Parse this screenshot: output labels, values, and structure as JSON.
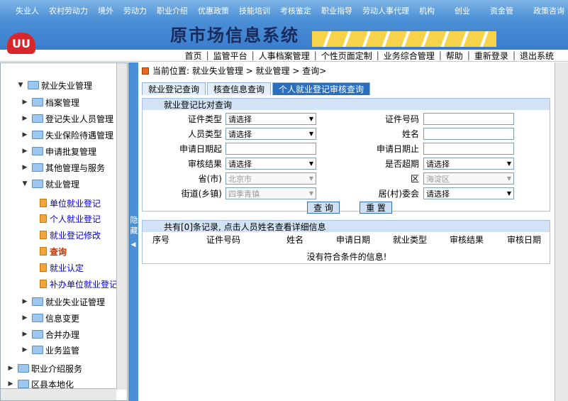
{
  "topnav": [
    "失业人",
    "农村劳动力",
    "境外",
    "劳动力",
    "职业介绍",
    "优惠政策",
    "技能培训",
    "考核鉴定",
    "职业指导",
    "劳动人事代理",
    "机构",
    "",
    "创业",
    "",
    "资金管",
    "",
    "政策咨询"
  ],
  "banner": {
    "logo": "UU",
    "title": "原市场信息系统"
  },
  "links": [
    "首页",
    "监管平台",
    "人事档案管理",
    "个性页面定制",
    "业务综合管理",
    "帮助",
    "重新登录",
    "退出系统"
  ],
  "tree": [
    {
      "label": "就业失业管理",
      "open": true,
      "kind": "folder"
    },
    {
      "label": "档案管理",
      "kind": "folder"
    },
    {
      "label": "登记失业人员管理",
      "kind": "folder"
    },
    {
      "label": "失业保险待遇管理",
      "kind": "folder"
    },
    {
      "label": "申请批复管理",
      "kind": "folder"
    },
    {
      "label": "其他管理与服务",
      "kind": "folder"
    },
    {
      "label": "就业管理",
      "open": true,
      "kind": "folder"
    },
    {
      "label": "单位就业登记",
      "kind": "doc"
    },
    {
      "label": "个人就业登记",
      "kind": "doc"
    },
    {
      "label": "就业登记修改",
      "kind": "doc"
    },
    {
      "label": "查询",
      "kind": "doc",
      "current": true
    },
    {
      "label": "就业认定",
      "kind": "doc"
    },
    {
      "label": "补办单位就业登记",
      "kind": "doc"
    },
    {
      "label": "就业失业证管理",
      "kind": "folder"
    },
    {
      "label": "信息变更",
      "kind": "folder"
    },
    {
      "label": "合并办理",
      "kind": "folder"
    },
    {
      "label": "业务监管",
      "kind": "folder"
    },
    {
      "label": "职业介绍服务",
      "kind": "folder"
    },
    {
      "label": "区县本地化",
      "kind": "folder"
    }
  ],
  "hidebar": "隐藏",
  "breadcrumb": "当前位置: 就业失业管理 > 就业管理 > 查询>",
  "tabs": [
    "就业登记查询",
    "核查信息查询",
    "个人就业登记审核查询"
  ],
  "form": {
    "header": "就业登记比对查询",
    "id_type_label": "证件类型",
    "id_type_value": "请选择",
    "id_no_label": "证件号码",
    "person_type_label": "人员类型",
    "person_type_value": "请选择",
    "name_label": "姓名",
    "start_label": "申请日期起",
    "end_label": "申请日期止",
    "audit_label": "审核结果",
    "audit_value": "请选择",
    "overdue_label": "是否超期",
    "overdue_value": "请选择",
    "province_label": "省(市)",
    "province_value": "北京市",
    "district_label": "区",
    "district_value": "海淀区",
    "street_label": "街道(乡镇)",
    "street_value": "四季青镇",
    "committee_label": "居(村)委会",
    "committee_value": "请选择",
    "query_button": "查 询",
    "reset_button": "重 置"
  },
  "results": {
    "header": "共有[0]条记录, 点击人员姓名查看详细信息",
    "columns": [
      "序号",
      "证件号码",
      "姓名",
      "申请日期",
      "就业类型",
      "审核结果",
      "审核日期"
    ],
    "empty": "没有符合条件的信息!"
  }
}
